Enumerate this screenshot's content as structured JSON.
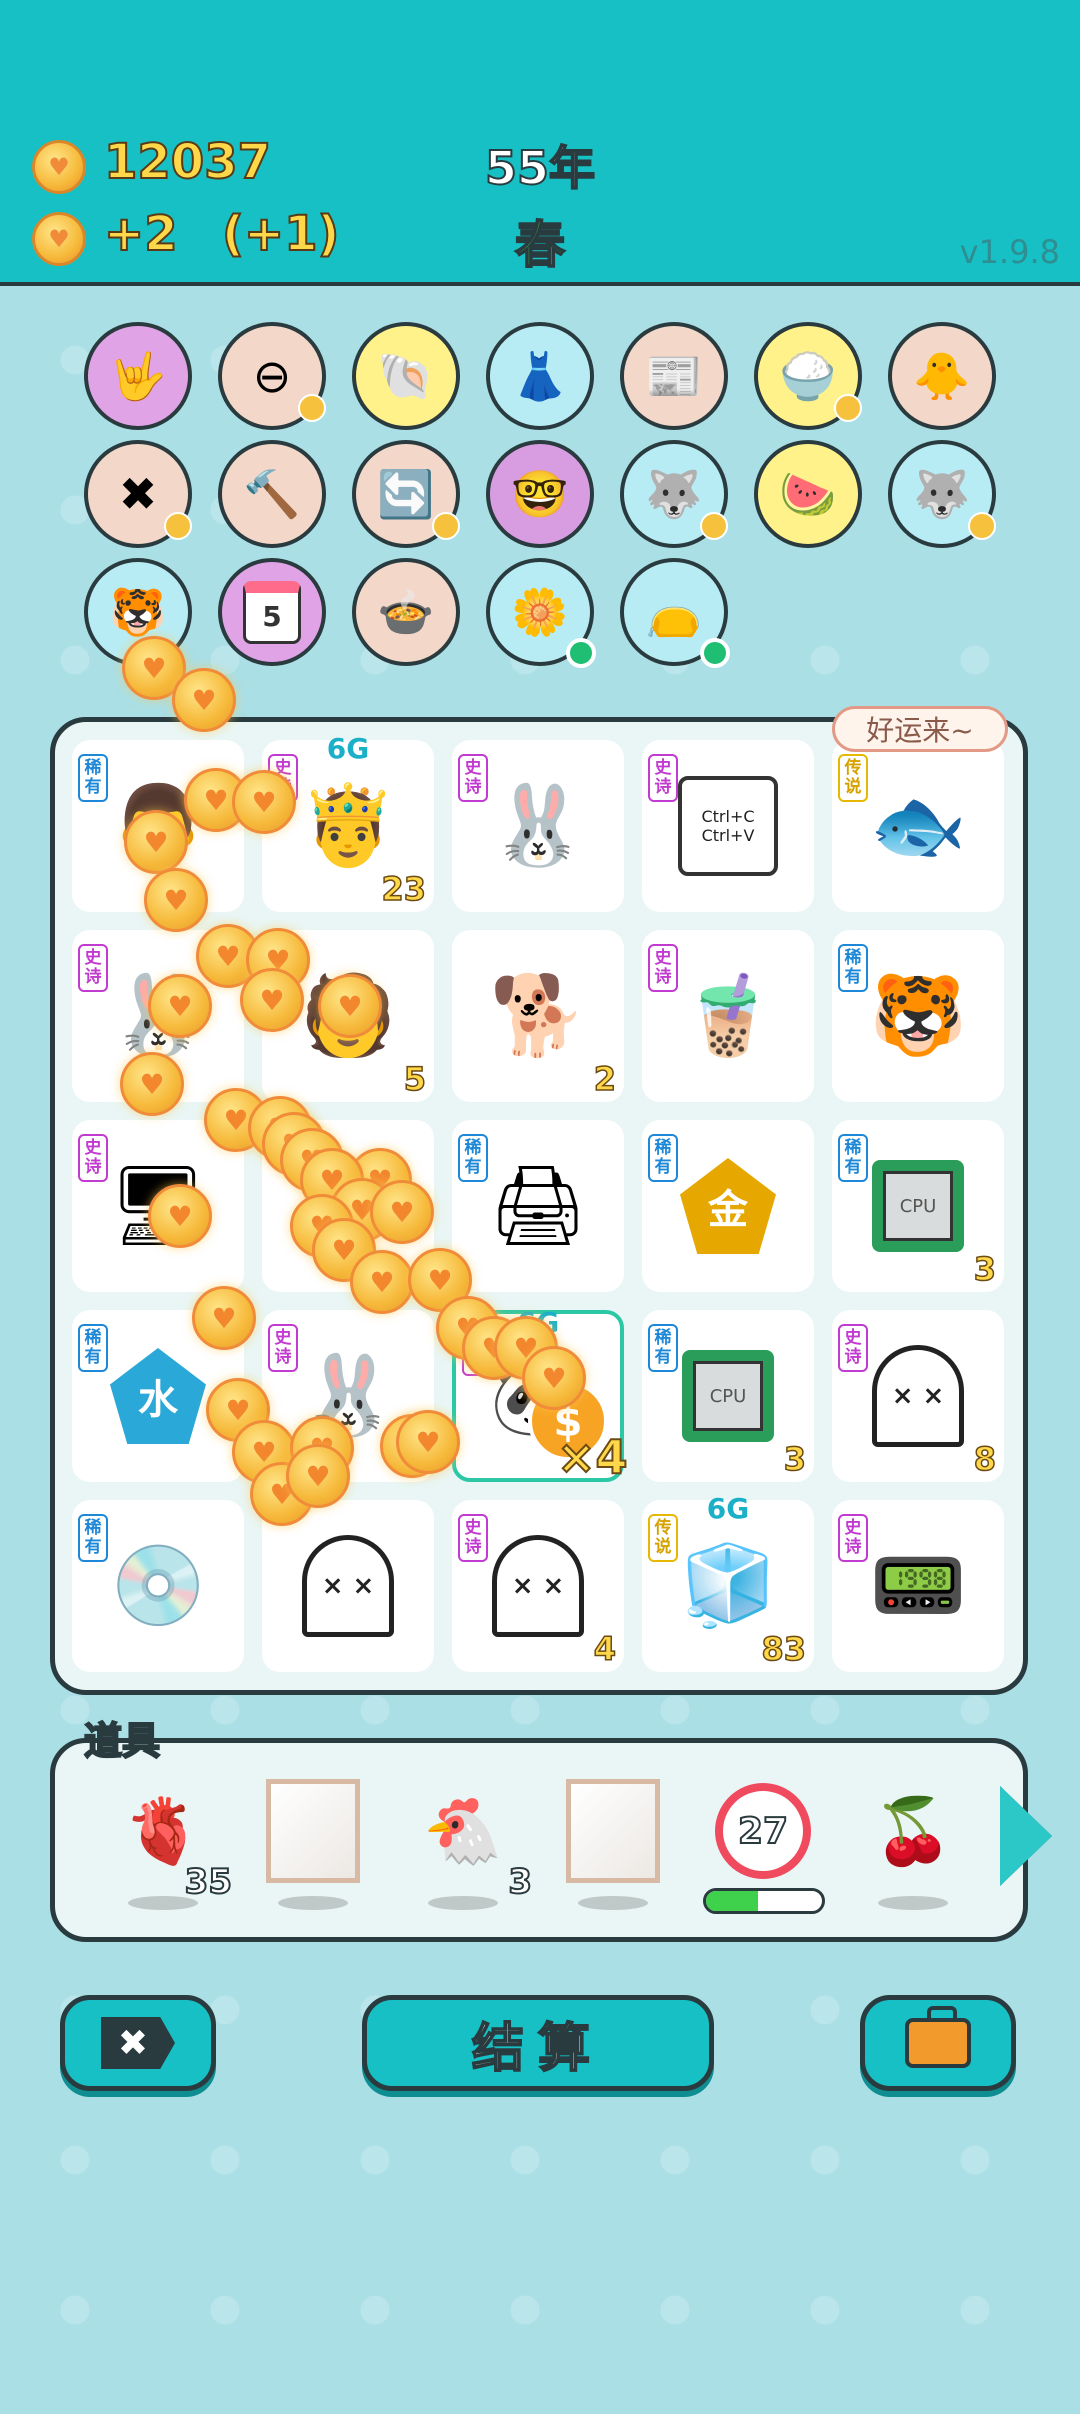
{
  "header": {
    "coins": "12037",
    "income": "+2",
    "income_bonus": "(+1)",
    "year": "55年",
    "season": "春",
    "version": "v1.9.8"
  },
  "buffs": [
    {
      "name": "rock-hand",
      "glyph": "🤟",
      "bg": "#e0a3e6",
      "mini": false
    },
    {
      "name": "no-entry",
      "glyph": "⊖",
      "bg": "#f3d7c9",
      "mini": true
    },
    {
      "name": "shell",
      "glyph": "🐚",
      "bg": "#fff28a",
      "mini": false
    },
    {
      "name": "skirt",
      "glyph": "👗",
      "bg": "#b8ecf5",
      "mini": false
    },
    {
      "name": "time-magazine",
      "glyph": "📰",
      "bg": "#f3d7c9",
      "mini": false
    },
    {
      "name": "rice-bowl",
      "glyph": "🍚",
      "bg": "#fff28a",
      "mini": true
    },
    {
      "name": "chick",
      "glyph": "🐥",
      "bg": "#f3d7c9",
      "mini": false
    },
    {
      "name": "remove-tag",
      "glyph": "✖",
      "bg": "#f3d7c9",
      "mini": true
    },
    {
      "name": "hammer",
      "glyph": "🔨",
      "bg": "#f3d7c9",
      "mini": false
    },
    {
      "name": "refresh",
      "glyph": "🔄",
      "bg": "#f3d7c9",
      "mini": true
    },
    {
      "name": "math-nerd",
      "glyph": "🤓",
      "bg": "#d89de0",
      "mini": false
    },
    {
      "name": "husky",
      "glyph": "🐺",
      "bg": "#b8ecf5",
      "mini": true
    },
    {
      "name": "fruits",
      "glyph": "🍉",
      "bg": "#fff28a",
      "mini": false
    },
    {
      "name": "husky-2",
      "glyph": "🐺",
      "bg": "#b8ecf5",
      "mini": true
    },
    {
      "name": "tiger-tail",
      "glyph": "🐯",
      "bg": "#b8ecf5",
      "mini": false
    },
    {
      "name": "calendar",
      "glyph": "5",
      "bg": "#e0a3e6",
      "mini": false
    },
    {
      "name": "pot-duck",
      "glyph": "🍲",
      "bg": "#f3d7c9",
      "mini": false
    },
    {
      "name": "flower-pot",
      "glyph": "🌼",
      "bg": "#b8ecf5",
      "dot": true
    },
    {
      "name": "sack",
      "glyph": "👝",
      "bg": "#b8ecf5",
      "dot": true
    }
  ],
  "board": {
    "bubble": "好运来~",
    "multiplier": "×4",
    "dollar": "$",
    "cells": [
      {
        "tag": "稀有",
        "tier": "rare",
        "kind": "emoji",
        "glyph": "👨",
        "count": ""
      },
      {
        "tag": "史诗",
        "tier": "epic",
        "kind": "emoji",
        "glyph": "🤴",
        "count": "23",
        "sixg": "6G"
      },
      {
        "tag": "史诗",
        "tier": "epic",
        "kind": "emoji",
        "glyph": "🐰",
        "count": ""
      },
      {
        "tag": "史诗",
        "tier": "epic",
        "kind": "ctrl",
        "l1": "Ctrl+C",
        "l2": "Ctrl+V",
        "count": ""
      },
      {
        "tag": "传说",
        "tier": "leg",
        "kind": "emoji",
        "glyph": "🐟",
        "count": ""
      },
      {
        "tag": "史诗",
        "tier": "epic",
        "kind": "emoji",
        "glyph": "🐰",
        "count": ""
      },
      {
        "tag": "",
        "tier": "",
        "kind": "emoji",
        "glyph": "🧑",
        "count": "5"
      },
      {
        "tag": "",
        "tier": "",
        "kind": "emoji",
        "glyph": "🐕",
        "count": "2"
      },
      {
        "tag": "史诗",
        "tier": "epic",
        "kind": "emoji",
        "glyph": "🧋",
        "count": ""
      },
      {
        "tag": "稀有",
        "tier": "rare",
        "kind": "emoji",
        "glyph": "🐯",
        "count": ""
      },
      {
        "tag": "史诗",
        "tier": "epic",
        "kind": "emoji",
        "glyph": "🖥",
        "count": ""
      },
      {
        "tag": "",
        "tier": "",
        "kind": "emoji",
        "glyph": "",
        "count": ""
      },
      {
        "tag": "稀有",
        "tier": "rare",
        "kind": "emoji",
        "glyph": "🖨",
        "count": ""
      },
      {
        "tag": "稀有",
        "tier": "rare",
        "kind": "hex",
        "text": "金",
        "color": "#e6a800",
        "count": ""
      },
      {
        "tag": "稀有",
        "tier": "rare",
        "kind": "cpu",
        "text": "CPU",
        "count": "3"
      },
      {
        "tag": "稀有",
        "tier": "rare",
        "kind": "hex",
        "text": "水",
        "color": "#2aa8d8",
        "count": ""
      },
      {
        "tag": "史诗",
        "tier": "epic",
        "kind": "emoji",
        "glyph": "🐰",
        "count": ""
      },
      {
        "tag": "史诗",
        "tier": "epic",
        "kind": "emoji",
        "glyph": "🐼",
        "count": "",
        "sel": true,
        "sixg": "6G"
      },
      {
        "tag": "稀有",
        "tier": "rare",
        "kind": "cpu",
        "text": "CPU",
        "count": "3"
      },
      {
        "tag": "史诗",
        "tier": "epic",
        "kind": "ghost",
        "eyes": "× ×",
        "count": "8"
      },
      {
        "tag": "稀有",
        "tier": "rare",
        "kind": "emoji",
        "glyph": "💿",
        "count": ""
      },
      {
        "tag": "",
        "tier": "",
        "kind": "ghost",
        "eyes": "× ×",
        "count": ""
      },
      {
        "tag": "史诗",
        "tier": "epic",
        "kind": "ghost",
        "eyes": "× ×",
        "count": "4"
      },
      {
        "tag": "传说",
        "tier": "leg",
        "kind": "emoji",
        "glyph": "🧊",
        "count": "83",
        "sixg": "6G"
      },
      {
        "tag": "史诗",
        "tier": "epic",
        "kind": "emoji",
        "glyph": "📟",
        "count": ""
      }
    ]
  },
  "items": {
    "label": "道具",
    "list": [
      {
        "name": "liver",
        "glyph": "🫀",
        "count": "35"
      },
      {
        "name": "empty-frame",
        "frame": true,
        "count": ""
      },
      {
        "name": "chicken",
        "glyph": "🐔",
        "count": "3"
      },
      {
        "name": "empty-frame",
        "frame": true,
        "count": ""
      },
      {
        "name": "timer",
        "timer": "27",
        "count": ""
      },
      {
        "name": "lychee",
        "glyph": "🍒",
        "count": ""
      }
    ],
    "timer_progress": 0.45
  },
  "buttons": {
    "remove": "✖",
    "settle": "结算"
  }
}
